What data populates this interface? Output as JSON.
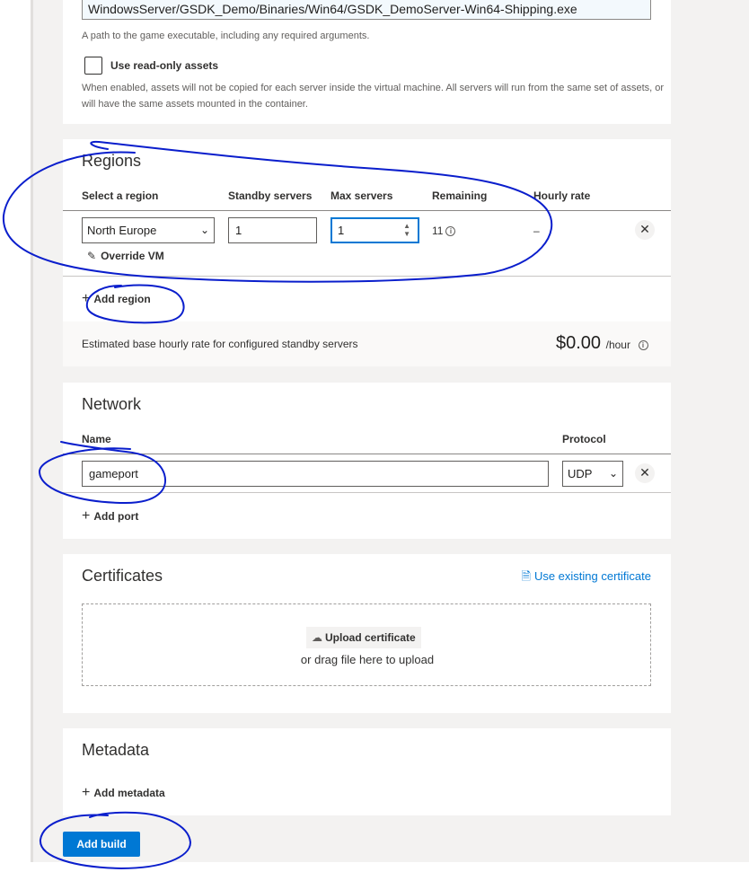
{
  "build": {
    "executable_value": "WindowsServer/GSDK_Demo/Binaries/Win64/GSDK_DemoServer-Win64-Shipping.exe",
    "executable_help": "A path to the game executable, including any required arguments.",
    "readonly_label": "Use read-only assets",
    "readonly_checked": false,
    "readonly_help_line1": "When enabled, assets will not be copied for each server inside the virtual machine. All servers will run from the same set of assets, or",
    "readonly_help_line2": "will have the same assets mounted in the container."
  },
  "regions": {
    "title": "Regions",
    "columns": {
      "region": "Select a region",
      "standby": "Standby servers",
      "max": "Max servers",
      "remaining": "Remaining",
      "rate": "Hourly rate"
    },
    "rows": [
      {
        "region": "North Europe",
        "standby": "1",
        "max": "1",
        "remaining": "11",
        "rate": "–",
        "override_label": "Override VM"
      }
    ],
    "add_label": "Add region",
    "estimate_label": "Estimated base hourly rate for configured standby servers",
    "estimate_price": "$0.00",
    "estimate_unit": "/hour"
  },
  "network": {
    "title": "Network",
    "columns": {
      "name": "Name",
      "protocol": "Protocol"
    },
    "ports": [
      {
        "name": "gameport",
        "protocol": "UDP"
      }
    ],
    "add_label": "Add port"
  },
  "certificates": {
    "title": "Certificates",
    "use_existing_label": "Use existing certificate",
    "upload_label": "Upload certificate",
    "drag_text": "or drag file here to upload"
  },
  "metadata": {
    "title": "Metadata",
    "add_label": "Add metadata"
  },
  "actions": {
    "add_build_label": "Add build"
  },
  "colors": {
    "accent": "#0078d4",
    "annotation": "#0a1ecc",
    "page_bg": "#f3f2f1"
  }
}
